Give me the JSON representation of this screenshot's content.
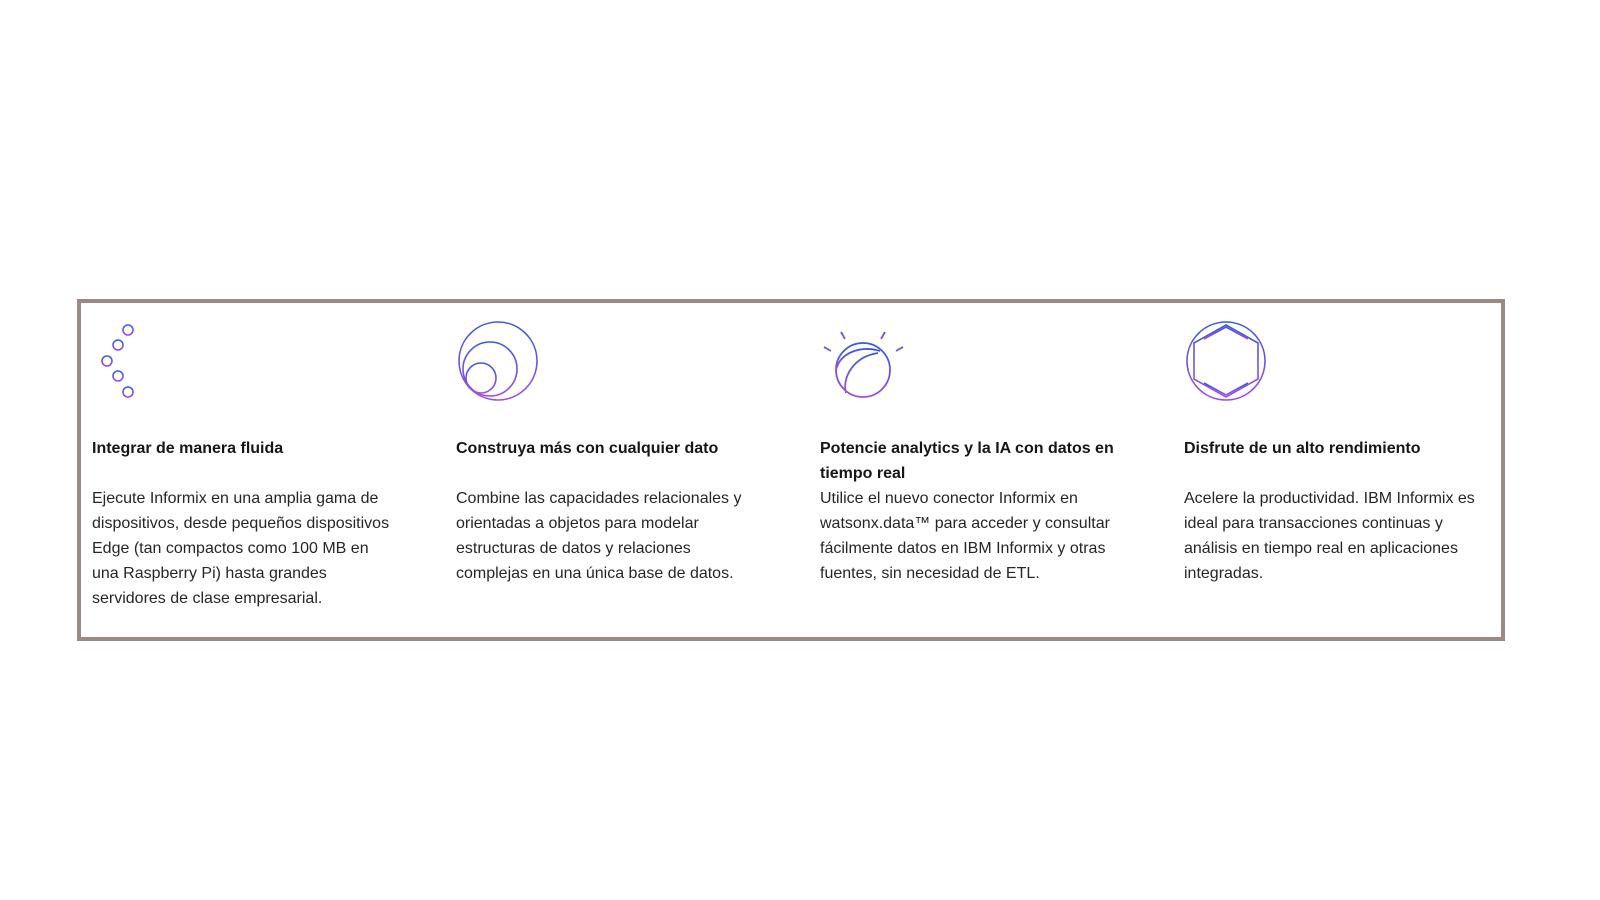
{
  "features": [
    {
      "icon": "integration-list-icon",
      "title": "Integrar de manera fluida",
      "description": "Ejecute Informix en una amplia gama de dispositivos, desde pequeños dispositivos Edge (tan compactos como 100 MB en una Raspberry Pi) hasta grandes servidores de clase empresarial."
    },
    {
      "icon": "nested-circles-icon",
      "title": "Construya más con cualquier dato",
      "description": "Combine las capacidades relacionales y orientadas a objetos para modelar estructuras de datos y relaciones complejas en una única base de datos."
    },
    {
      "icon": "ai-globe-icon",
      "title": "Potencie analytics y la IA con datos en tiempo real",
      "description": "Utilice el nuevo conector Informix en watsonx.data™ para acceder y consultar fácilmente datos en IBM Informix y otras fuentes, sin necesidad de ETL."
    },
    {
      "icon": "performance-chart-icon",
      "title": "Disfrute de un alto rendimiento",
      "description": "Acelere la productividad. IBM Informix es ideal para transacciones continuas y análisis en tiempo real en aplicaciones integradas."
    }
  ],
  "colors": {
    "frame_border": "#9b8a84",
    "gradient_blue": "#3b5bdb",
    "gradient_purple": "#a04ee0"
  }
}
